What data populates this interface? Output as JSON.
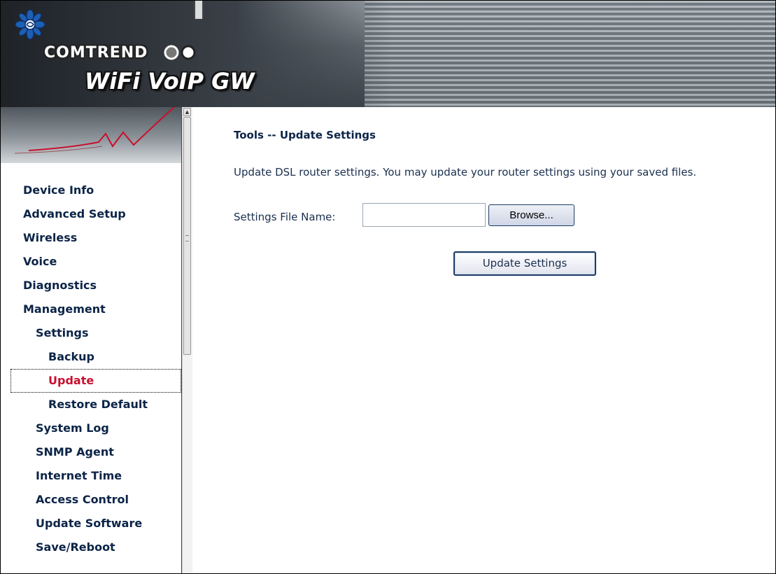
{
  "banner": {
    "brand": "COMTREND",
    "product": "WiFi VoIP GW"
  },
  "nav": {
    "items": [
      {
        "label": "Device Info"
      },
      {
        "label": "Advanced Setup"
      },
      {
        "label": "Wireless"
      },
      {
        "label": "Voice"
      },
      {
        "label": "Diagnostics"
      },
      {
        "label": "Management"
      },
      {
        "label": "Settings"
      },
      {
        "label": "Backup"
      },
      {
        "label": "Update",
        "selected": true
      },
      {
        "label": "Restore Default"
      },
      {
        "label": "System Log"
      },
      {
        "label": "SNMP Agent"
      },
      {
        "label": "Internet Time"
      },
      {
        "label": "Access Control"
      },
      {
        "label": "Update Software"
      },
      {
        "label": "Save/Reboot"
      }
    ]
  },
  "main": {
    "title": "Tools -- Update Settings",
    "description": "Update DSL router settings. You may update your router settings using your saved files.",
    "file_label": "Settings File Name:",
    "file_value": "",
    "browse_label": "Browse...",
    "update_label": "Update Settings"
  },
  "colors": {
    "nav_text": "#0b2447",
    "nav_active": "#c8102e",
    "sidebar_border": "#c8102e"
  },
  "icons": [
    "logo-flower-icon",
    "brand-rings-icon",
    "scroll-up-arrow-icon"
  ]
}
